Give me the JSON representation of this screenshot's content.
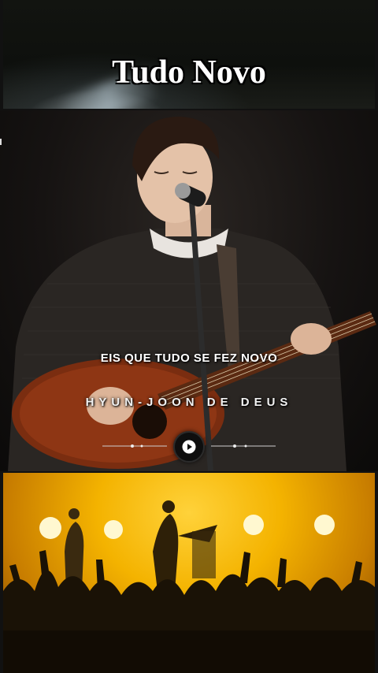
{
  "header": {
    "title": "Tudo Novo"
  },
  "video": {
    "lyric_line": "EIS QUE TUDO SE FEZ NOVO",
    "artist_name": "HYUN-JOON DE DEUS"
  },
  "player": {
    "play_icon": "play-icon"
  },
  "colors": {
    "title_text": "#ffffff",
    "concert_glow": "#f4b300",
    "background": "#111111"
  }
}
